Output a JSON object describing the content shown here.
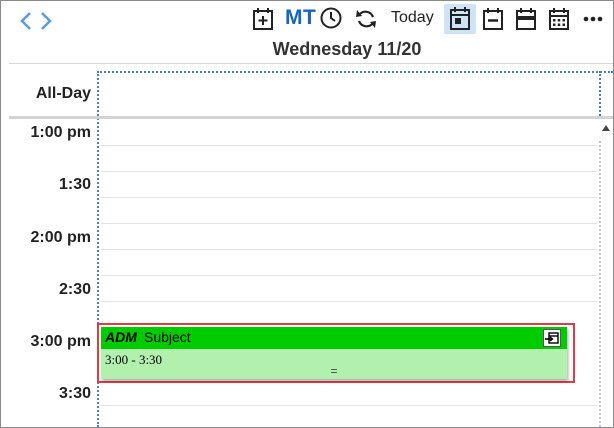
{
  "toolbar": {
    "mt_label": "MT",
    "today_label": "Today",
    "icons": [
      "chevron-left-icon",
      "chevron-right-icon",
      "add-event-icon",
      "clock-icon",
      "refresh-icon",
      "day-view-icon",
      "week-view-icon",
      "workweek-view-icon",
      "month-view-icon",
      "more-icon"
    ],
    "accent_color": "#1565c0",
    "active_view_bg": "#cfe3f7"
  },
  "header": {
    "date_title": "Wednesday 11/20"
  },
  "allday": {
    "label": "All-Day"
  },
  "times": [
    "1:00 pm",
    "1:30",
    "2:00 pm",
    "2:30",
    "3:00 pm",
    "3:30"
  ],
  "event": {
    "category": "ADM",
    "subject": "Subject",
    "time_range": "3:00 - 3:30",
    "resize_glyph": "=",
    "header_color": "#00cc00",
    "body_color": "#b2f0ae",
    "selection_color": "#e53945"
  }
}
